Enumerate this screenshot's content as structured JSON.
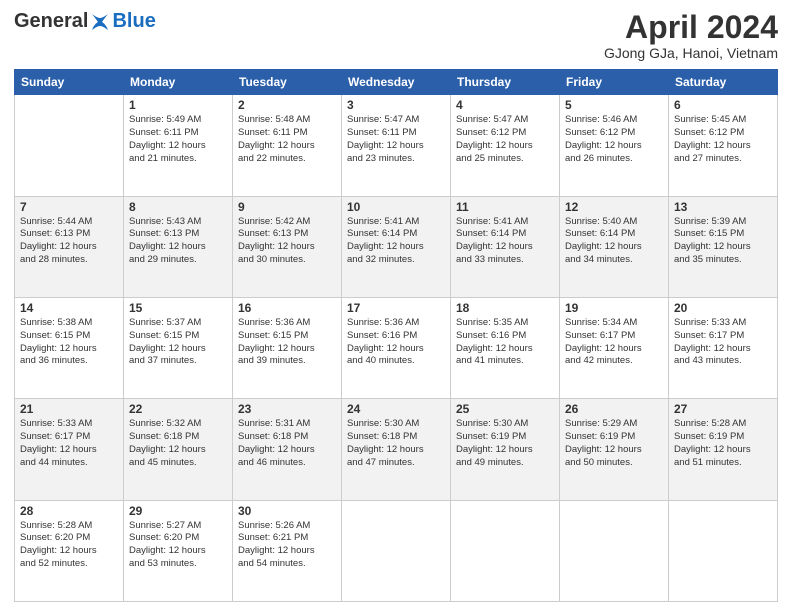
{
  "header": {
    "logo_general": "General",
    "logo_blue": "Blue",
    "title": "April 2024",
    "location": "GJong GJa, Hanoi, Vietnam"
  },
  "calendar": {
    "days_of_week": [
      "Sunday",
      "Monday",
      "Tuesday",
      "Wednesday",
      "Thursday",
      "Friday",
      "Saturday"
    ],
    "weeks": [
      [
        {
          "day": "",
          "info": ""
        },
        {
          "day": "1",
          "info": "Sunrise: 5:49 AM\nSunset: 6:11 PM\nDaylight: 12 hours\nand 21 minutes."
        },
        {
          "day": "2",
          "info": "Sunrise: 5:48 AM\nSunset: 6:11 PM\nDaylight: 12 hours\nand 22 minutes."
        },
        {
          "day": "3",
          "info": "Sunrise: 5:47 AM\nSunset: 6:11 PM\nDaylight: 12 hours\nand 23 minutes."
        },
        {
          "day": "4",
          "info": "Sunrise: 5:47 AM\nSunset: 6:12 PM\nDaylight: 12 hours\nand 25 minutes."
        },
        {
          "day": "5",
          "info": "Sunrise: 5:46 AM\nSunset: 6:12 PM\nDaylight: 12 hours\nand 26 minutes."
        },
        {
          "day": "6",
          "info": "Sunrise: 5:45 AM\nSunset: 6:12 PM\nDaylight: 12 hours\nand 27 minutes."
        }
      ],
      [
        {
          "day": "7",
          "info": "Sunrise: 5:44 AM\nSunset: 6:13 PM\nDaylight: 12 hours\nand 28 minutes."
        },
        {
          "day": "8",
          "info": "Sunrise: 5:43 AM\nSunset: 6:13 PM\nDaylight: 12 hours\nand 29 minutes."
        },
        {
          "day": "9",
          "info": "Sunrise: 5:42 AM\nSunset: 6:13 PM\nDaylight: 12 hours\nand 30 minutes."
        },
        {
          "day": "10",
          "info": "Sunrise: 5:41 AM\nSunset: 6:14 PM\nDaylight: 12 hours\nand 32 minutes."
        },
        {
          "day": "11",
          "info": "Sunrise: 5:41 AM\nSunset: 6:14 PM\nDaylight: 12 hours\nand 33 minutes."
        },
        {
          "day": "12",
          "info": "Sunrise: 5:40 AM\nSunset: 6:14 PM\nDaylight: 12 hours\nand 34 minutes."
        },
        {
          "day": "13",
          "info": "Sunrise: 5:39 AM\nSunset: 6:15 PM\nDaylight: 12 hours\nand 35 minutes."
        }
      ],
      [
        {
          "day": "14",
          "info": "Sunrise: 5:38 AM\nSunset: 6:15 PM\nDaylight: 12 hours\nand 36 minutes."
        },
        {
          "day": "15",
          "info": "Sunrise: 5:37 AM\nSunset: 6:15 PM\nDaylight: 12 hours\nand 37 minutes."
        },
        {
          "day": "16",
          "info": "Sunrise: 5:36 AM\nSunset: 6:15 PM\nDaylight: 12 hours\nand 39 minutes."
        },
        {
          "day": "17",
          "info": "Sunrise: 5:36 AM\nSunset: 6:16 PM\nDaylight: 12 hours\nand 40 minutes."
        },
        {
          "day": "18",
          "info": "Sunrise: 5:35 AM\nSunset: 6:16 PM\nDaylight: 12 hours\nand 41 minutes."
        },
        {
          "day": "19",
          "info": "Sunrise: 5:34 AM\nSunset: 6:17 PM\nDaylight: 12 hours\nand 42 minutes."
        },
        {
          "day": "20",
          "info": "Sunrise: 5:33 AM\nSunset: 6:17 PM\nDaylight: 12 hours\nand 43 minutes."
        }
      ],
      [
        {
          "day": "21",
          "info": "Sunrise: 5:33 AM\nSunset: 6:17 PM\nDaylight: 12 hours\nand 44 minutes."
        },
        {
          "day": "22",
          "info": "Sunrise: 5:32 AM\nSunset: 6:18 PM\nDaylight: 12 hours\nand 45 minutes."
        },
        {
          "day": "23",
          "info": "Sunrise: 5:31 AM\nSunset: 6:18 PM\nDaylight: 12 hours\nand 46 minutes."
        },
        {
          "day": "24",
          "info": "Sunrise: 5:30 AM\nSunset: 6:18 PM\nDaylight: 12 hours\nand 47 minutes."
        },
        {
          "day": "25",
          "info": "Sunrise: 5:30 AM\nSunset: 6:19 PM\nDaylight: 12 hours\nand 49 minutes."
        },
        {
          "day": "26",
          "info": "Sunrise: 5:29 AM\nSunset: 6:19 PM\nDaylight: 12 hours\nand 50 minutes."
        },
        {
          "day": "27",
          "info": "Sunrise: 5:28 AM\nSunset: 6:19 PM\nDaylight: 12 hours\nand 51 minutes."
        }
      ],
      [
        {
          "day": "28",
          "info": "Sunrise: 5:28 AM\nSunset: 6:20 PM\nDaylight: 12 hours\nand 52 minutes."
        },
        {
          "day": "29",
          "info": "Sunrise: 5:27 AM\nSunset: 6:20 PM\nDaylight: 12 hours\nand 53 minutes."
        },
        {
          "day": "30",
          "info": "Sunrise: 5:26 AM\nSunset: 6:21 PM\nDaylight: 12 hours\nand 54 minutes."
        },
        {
          "day": "",
          "info": ""
        },
        {
          "day": "",
          "info": ""
        },
        {
          "day": "",
          "info": ""
        },
        {
          "day": "",
          "info": ""
        }
      ]
    ]
  }
}
